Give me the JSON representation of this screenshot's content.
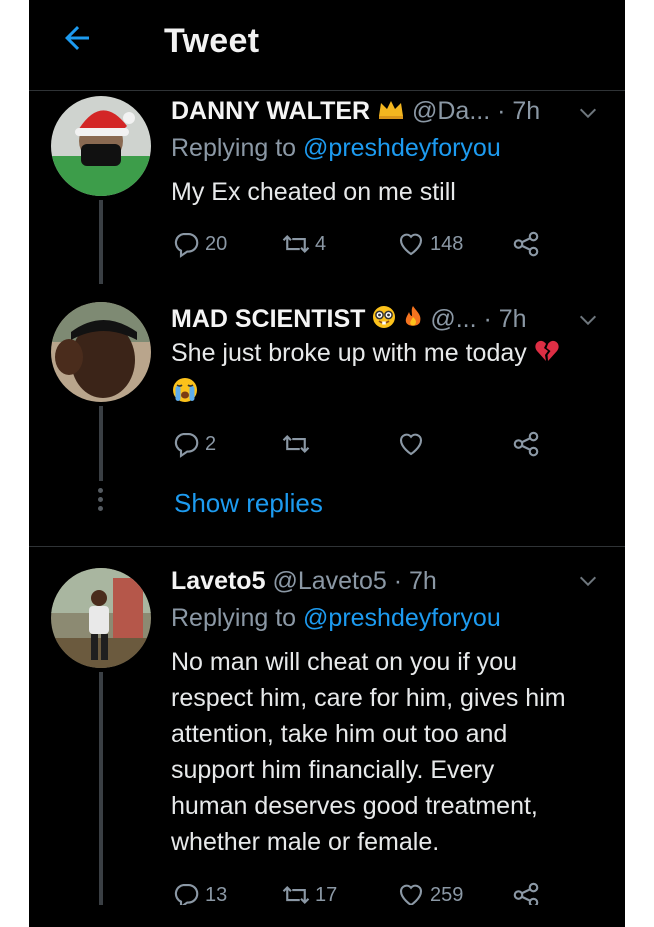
{
  "header": {
    "title": "Tweet"
  },
  "tweets": [
    {
      "name": "DANNY WALTER",
      "handle": "@Da...",
      "time": "· 7h",
      "replying_prefix": "Replying to",
      "replying_to": "@preshdeyforyou",
      "text": "My Ex cheated on me still",
      "replies": "20",
      "retweets": "4",
      "likes": "148"
    },
    {
      "name": "MAD SCIENTIST",
      "handle": "@...",
      "time": "· 7h",
      "text": "She just broke up with me today",
      "replies": "2",
      "retweets": "",
      "likes": "",
      "show_replies": "Show replies"
    },
    {
      "name": "Laveto5",
      "handle": "@Laveto5",
      "time": "· 7h",
      "replying_prefix": "Replying to",
      "replying_to": "@preshdeyforyou",
      "text_lines": [
        "No man will cheat on you if you",
        "respect him, care for him, gives him",
        "attention, take him out too and",
        "support him financially. Every",
        "human deserves good treatment,",
        "whether male or female."
      ],
      "replies": "13",
      "retweets": "17",
      "likes": "259"
    }
  ],
  "colors": {
    "background": "#000000",
    "accent": "#1d9bf0",
    "muted": "#8b98a5",
    "text": "#e7e9ea"
  },
  "icons": [
    "back-arrow-icon",
    "chevron-down-icon",
    "reply-icon",
    "retweet-icon",
    "like-icon",
    "share-icon",
    "crown-emoji",
    "nerd-face-emoji",
    "fire-emoji",
    "broken-heart-emoji",
    "crying-face-emoji"
  ]
}
